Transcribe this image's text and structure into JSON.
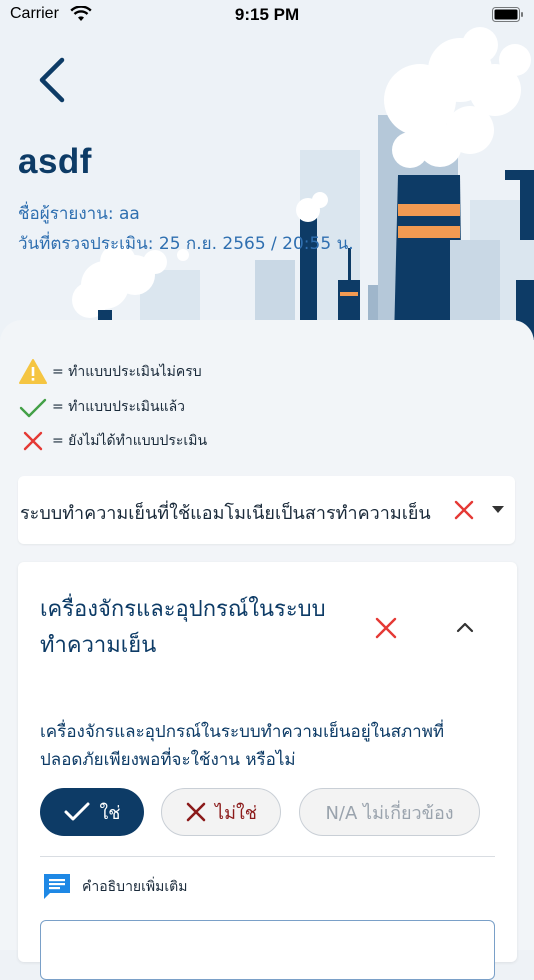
{
  "status_bar": {
    "carrier": "Carrier",
    "time": "9:15 PM"
  },
  "header": {
    "title": "asdf",
    "reporter": "ชื่อผู้รายงาน: aa",
    "date": "วันที่ตรวจประเมิน: 25 ก.ย. 2565 / 20:55 น."
  },
  "legend": [
    {
      "icon": "warning-triangle-icon",
      "label": "= ทำแบบประเมินไม่ครบ"
    },
    {
      "icon": "check-icon",
      "label": "= ทำแบบประเมินแล้ว"
    },
    {
      "icon": "cross-icon",
      "label": "= ยังไม่ได้ทำแบบประเมิน"
    }
  ],
  "category": {
    "selected": "ระบบทำความเย็นที่ใช้แอมโมเนียเป็นสารทำความเย็น"
  },
  "section": {
    "title": "เครื่องจักรและอุปกรณ์ในระบบทำความเย็น",
    "question": "เครื่องจักรและอุปกรณ์ในระบบทำความเย็นอยู่ในสภาพที่ปลอดภัยเพียงพอที่จะใช้งาน หรือไม่",
    "answers": {
      "yes": "ใช่",
      "no": "ไม่ใช่",
      "na": "N/A ไม่เกี่ยวข้อง"
    },
    "selected_answer": "ใช่",
    "note_label": "คำอธิบายเพิ่มเติม",
    "note_value": ""
  },
  "colors": {
    "primary": "#0d3b66",
    "link": "#2f6fb0",
    "danger": "#e53935",
    "success": "#43a047",
    "warning": "#f5c542",
    "background": "#f2f5f8"
  }
}
